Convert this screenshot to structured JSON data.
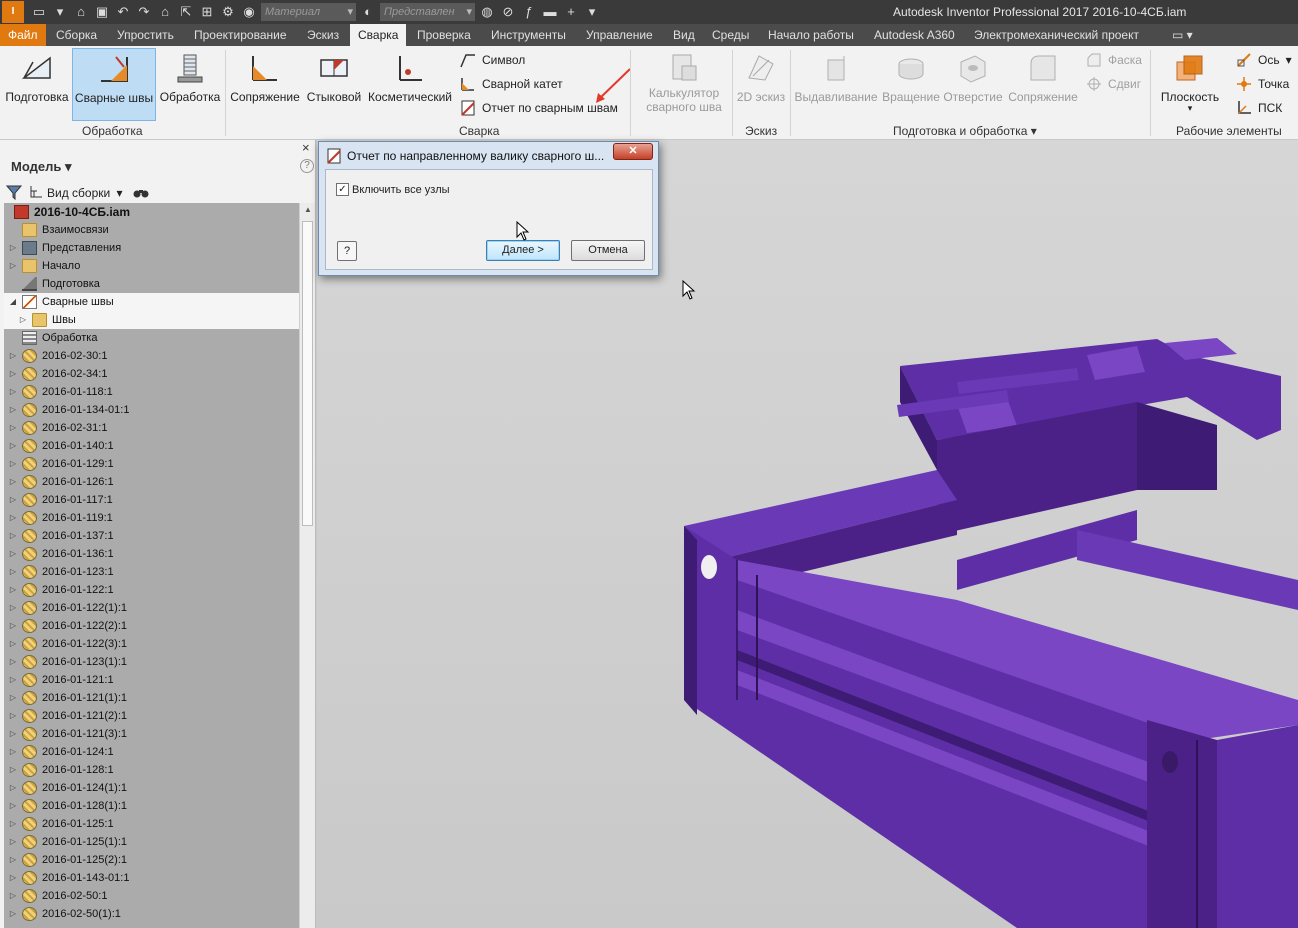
{
  "titlebar": {
    "logo_text": "I",
    "material_placeholder": "Материал",
    "appearance_placeholder": "Представлен",
    "title": "Autodesk Inventor Professional 2017    2016-10-4СБ.iam",
    "qat_icons": [
      "new-icon",
      "open-icon",
      "save-icon",
      "undo-icon",
      "redo-icon",
      "home-icon",
      "select-icon",
      "measure-icon",
      "update-icon",
      "color-icon",
      "clear-override-icon",
      "fx-icon",
      "align-icon",
      "plus-icon",
      "more-icon"
    ]
  },
  "tabs": [
    "Файл",
    "Сборка",
    "Упростить",
    "Проектирование",
    "Эскиз",
    "Сварка",
    "Проверка",
    "Инструменты",
    "Управление",
    "Вид",
    "Среды",
    "Начало работы",
    "Autodesk A360",
    "Электромеханический проект"
  ],
  "active_tab": "Сварка",
  "ribbon": {
    "prep_label": "Подготовка",
    "welds_label": "Сварные швы",
    "mach_label": "Обработка",
    "group_processing": "Обработка",
    "fillet_label": "Сопряжение",
    "groove_label": "Стыковой",
    "cosmetic_label": "Косметический",
    "symbol_label": "Символ",
    "weld_bead_label": "Сварной катет",
    "bead_report_label": "Отчет по сварным швам",
    "group_weld": "Сварка",
    "calc_label_1": "Калькулятор",
    "calc_label_2": "сварного шва",
    "sketch2d_label": "2D эскиз",
    "group_sketch": "Эскиз",
    "extrude_label": "Выдавливание",
    "revolve_label": "Вращение",
    "hole_label": "Отверстие",
    "fillet2_label": "Сопряжение",
    "chamfer_label": "Фаска",
    "move_label": "Сдвиг",
    "group_prep": "Подготовка и обработка",
    "plane_label": "Плоскость",
    "axis_label": "Ось",
    "point_label": "Точка",
    "ucs_label": "ПСК",
    "group_workfeatures": "Рабочие элементы"
  },
  "browser": {
    "title": "Модель",
    "close": "×",
    "help": "?",
    "view_label": "Вид сборки",
    "nodes": [
      {
        "label": "2016-10-4СБ.iam",
        "icon": "asm",
        "level": 0,
        "bold": true
      },
      {
        "label": "Взаимосвязи",
        "icon": "folder",
        "level": 1
      },
      {
        "label": "Представления",
        "icon": "repr",
        "level": 1,
        "exp": true
      },
      {
        "label": "Начало",
        "icon": "folder",
        "level": 1,
        "exp": true
      },
      {
        "label": "Подготовка",
        "icon": "prep",
        "level": 1
      },
      {
        "label": "Сварные швы",
        "icon": "weld",
        "level": 1,
        "exp": true,
        "open": true,
        "hl": true
      },
      {
        "label": "Швы",
        "icon": "folder",
        "level": 2,
        "exp": true,
        "hl": true
      },
      {
        "label": "Обработка",
        "icon": "mach",
        "level": 1
      },
      {
        "label": "2016-02-30:1",
        "icon": "part",
        "level": 1,
        "exp": true
      },
      {
        "label": "2016-02-34:1",
        "icon": "part",
        "level": 1,
        "exp": true
      },
      {
        "label": "2016-01-118:1",
        "icon": "part",
        "level": 1,
        "exp": true
      },
      {
        "label": "2016-01-134-01:1",
        "icon": "part",
        "level": 1,
        "exp": true
      },
      {
        "label": "2016-02-31:1",
        "icon": "part",
        "level": 1,
        "exp": true
      },
      {
        "label": "2016-01-140:1",
        "icon": "part",
        "level": 1,
        "exp": true
      },
      {
        "label": "2016-01-129:1",
        "icon": "part",
        "level": 1,
        "exp": true
      },
      {
        "label": "2016-01-126:1",
        "icon": "part",
        "level": 1,
        "exp": true
      },
      {
        "label": "2016-01-117:1",
        "icon": "part",
        "level": 1,
        "exp": true
      },
      {
        "label": "2016-01-119:1",
        "icon": "part",
        "level": 1,
        "exp": true
      },
      {
        "label": "2016-01-137:1",
        "icon": "part",
        "level": 1,
        "exp": true
      },
      {
        "label": "2016-01-136:1",
        "icon": "part",
        "level": 1,
        "exp": true
      },
      {
        "label": "2016-01-123:1",
        "icon": "part",
        "level": 1,
        "exp": true
      },
      {
        "label": "2016-01-122:1",
        "icon": "part",
        "level": 1,
        "exp": true
      },
      {
        "label": "2016-01-122(1):1",
        "icon": "part",
        "level": 1,
        "exp": true
      },
      {
        "label": "2016-01-122(2):1",
        "icon": "part",
        "level": 1,
        "exp": true
      },
      {
        "label": "2016-01-122(3):1",
        "icon": "part",
        "level": 1,
        "exp": true
      },
      {
        "label": "2016-01-123(1):1",
        "icon": "part",
        "level": 1,
        "exp": true
      },
      {
        "label": "2016-01-121:1",
        "icon": "part",
        "level": 1,
        "exp": true
      },
      {
        "label": "2016-01-121(1):1",
        "icon": "part",
        "level": 1,
        "exp": true
      },
      {
        "label": "2016-01-121(2):1",
        "icon": "part",
        "level": 1,
        "exp": true
      },
      {
        "label": "2016-01-121(3):1",
        "icon": "part",
        "level": 1,
        "exp": true
      },
      {
        "label": "2016-01-124:1",
        "icon": "part",
        "level": 1,
        "exp": true
      },
      {
        "label": "2016-01-128:1",
        "icon": "part",
        "level": 1,
        "exp": true
      },
      {
        "label": "2016-01-124(1):1",
        "icon": "part",
        "level": 1,
        "exp": true
      },
      {
        "label": "2016-01-128(1):1",
        "icon": "part",
        "level": 1,
        "exp": true
      },
      {
        "label": "2016-01-125:1",
        "icon": "part",
        "level": 1,
        "exp": true
      },
      {
        "label": "2016-01-125(1):1",
        "icon": "part",
        "level": 1,
        "exp": true
      },
      {
        "label": "2016-01-125(2):1",
        "icon": "part",
        "level": 1,
        "exp": true
      },
      {
        "label": "2016-01-143-01:1",
        "icon": "part",
        "level": 1,
        "exp": true
      },
      {
        "label": "2016-02-50:1",
        "icon": "part",
        "level": 1,
        "exp": true
      },
      {
        "label": "2016-02-50(1):1",
        "icon": "part",
        "level": 1,
        "exp": true
      }
    ]
  },
  "dialog": {
    "title": "Отчет по направленному валику сварного ш...",
    "close": "✕",
    "include_all_label": "Включить все узлы",
    "include_all_checked": "✓",
    "help": "?",
    "next_label": "Далее >",
    "cancel_label": "Отмена"
  },
  "colors": {
    "accent": "#e07a10",
    "frame": "#5a2aa0",
    "frame_dark": "#3e1b74",
    "frame_light": "#7a46c4"
  }
}
